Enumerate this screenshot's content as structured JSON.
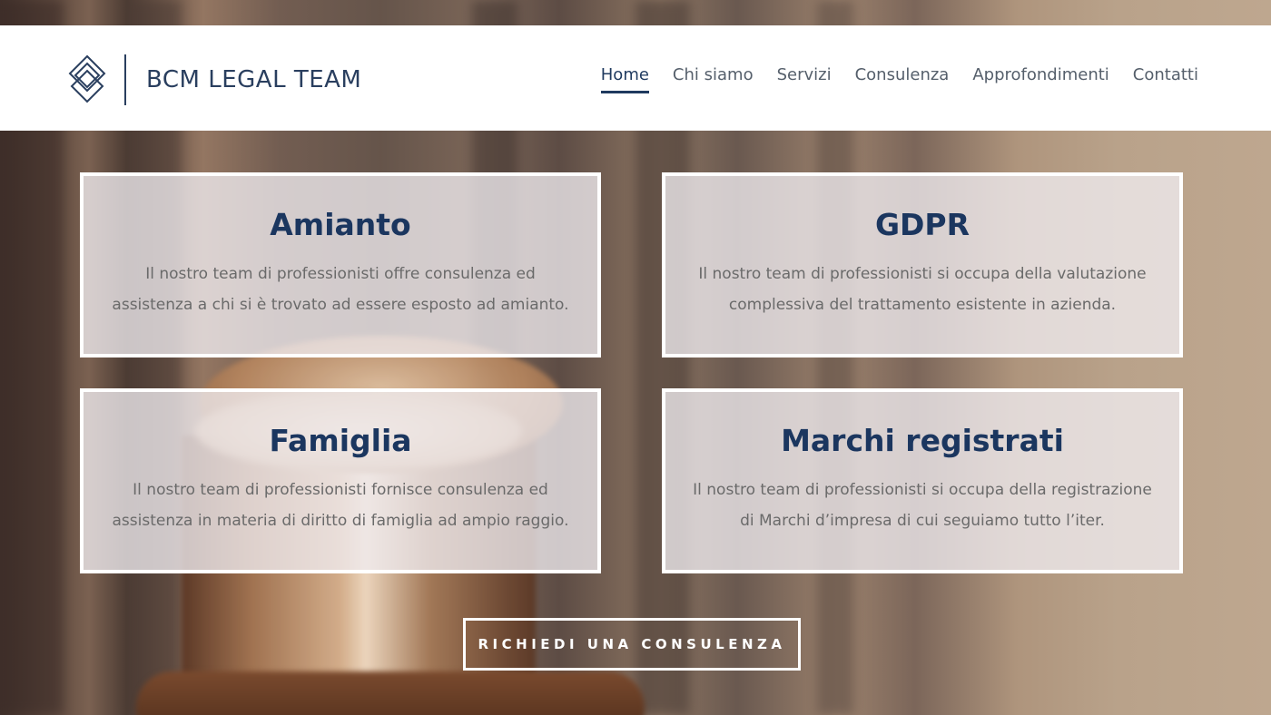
{
  "brand": {
    "name": "BCM LEGAL TEAM"
  },
  "nav": {
    "items": [
      {
        "label": "Home",
        "active": true
      },
      {
        "label": "Chi siamo"
      },
      {
        "label": "Servizi"
      },
      {
        "label": "Consulenza"
      },
      {
        "label": "Approfondimenti"
      },
      {
        "label": "Contatti"
      }
    ]
  },
  "services": [
    {
      "title": "Amianto",
      "lines": [
        "Il nostro team di professionisti offre consulenza ed",
        "assistenza a chi si è trovato ad essere esposto ad amianto."
      ]
    },
    {
      "title": "GDPR",
      "lines": [
        "Il nostro team di professionisti si occupa della valutazione",
        "complessiva del trattamento esistente in azienda."
      ]
    },
    {
      "title": "Famiglia",
      "lines": [
        "Il nostro team di professionisti fornisce consulenza ed",
        "assistenza in materia di diritto di famiglia ad ampio raggio."
      ]
    },
    {
      "title": "Marchi registrati",
      "lines": [
        "Il nostro team di professionisti si occupa della registrazione",
        "di Marchi d’impresa di cui seguiamo tutto l’iter."
      ]
    }
  ],
  "cta": {
    "label": "RICHIEDI UNA CONSULENZA"
  },
  "colors": {
    "primary": "#1b365f",
    "text_muted": "#6a6a6a",
    "header_bg": "#ffffff"
  }
}
